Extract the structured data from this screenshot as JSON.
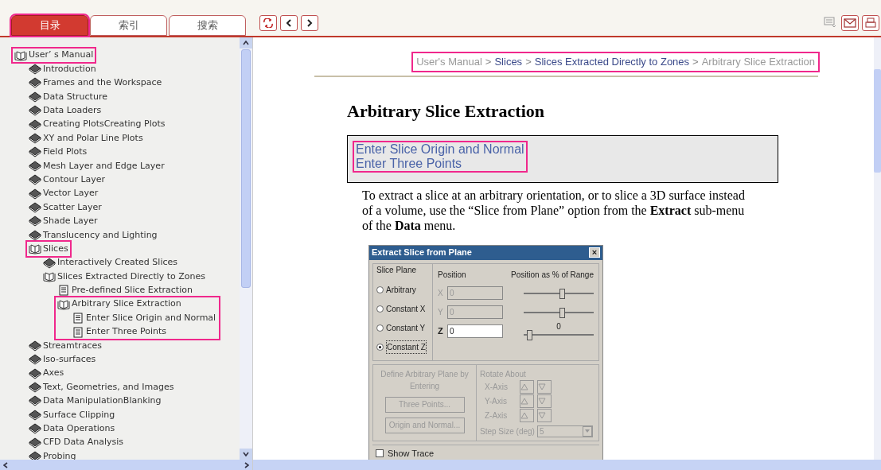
{
  "tabs": [
    {
      "label": "目录",
      "selected": true,
      "highlighted": true
    },
    {
      "label": "索引",
      "selected": false,
      "highlighted": false
    },
    {
      "label": "搜索",
      "selected": false,
      "highlighted": false
    }
  ],
  "tree": {
    "items": [
      {
        "label": "User’ s Manual",
        "kind": "book",
        "expanded": true,
        "highlighted": true,
        "highlight_children": false,
        "children": [
          {
            "label": "Introduction",
            "kind": "book",
            "expanded": false
          },
          {
            "label": "Frames and the Workspace",
            "kind": "book",
            "expanded": false
          },
          {
            "label": "Data Structure",
            "kind": "book",
            "expanded": false
          },
          {
            "label": "Data Loaders",
            "kind": "book",
            "expanded": false
          },
          {
            "label": "Creating PlotsCreating Plots",
            "kind": "book",
            "expanded": false
          },
          {
            "label": "XY and Polar Line Plots",
            "kind": "book",
            "expanded": false
          },
          {
            "label": "Field Plots",
            "kind": "book",
            "expanded": false
          },
          {
            "label": "Mesh Layer and Edge Layer",
            "kind": "book",
            "expanded": false
          },
          {
            "label": "Contour Layer",
            "kind": "book",
            "expanded": false
          },
          {
            "label": "Vector Layer",
            "kind": "book",
            "expanded": false
          },
          {
            "label": "Scatter Layer",
            "kind": "book",
            "expanded": false
          },
          {
            "label": "Shade Layer",
            "kind": "book",
            "expanded": false
          },
          {
            "label": "Translucency and Lighting",
            "kind": "book",
            "expanded": false
          },
          {
            "label": "Slices",
            "kind": "book",
            "expanded": true,
            "highlighted": true,
            "highlight_children": false,
            "children": [
              {
                "label": "Interactively Created Slices",
                "kind": "book",
                "expanded": false
              },
              {
                "label": "Slices Extracted Directly to Zones",
                "kind": "book",
                "expanded": true,
                "children": [
                  {
                    "label": "Pre-defined Slice Extraction",
                    "kind": "page"
                  },
                  {
                    "label": "Arbitrary Slice Extraction",
                    "kind": "book",
                    "expanded": true,
                    "highlighted": true,
                    "highlight_children": true,
                    "children": [
                      {
                        "label": "Enter Slice Origin and Normal",
                        "kind": "page"
                      },
                      {
                        "label": "Enter Three Points",
                        "kind": "page"
                      }
                    ]
                  }
                ]
              }
            ]
          },
          {
            "label": "Streamtraces",
            "kind": "book",
            "expanded": false
          },
          {
            "label": "Iso-surfaces",
            "kind": "book",
            "expanded": false
          },
          {
            "label": "Axes",
            "kind": "book",
            "expanded": false
          },
          {
            "label": "Text, Geometries, and Images",
            "kind": "book",
            "expanded": false
          },
          {
            "label": "Data ManipulationBlanking",
            "kind": "book",
            "expanded": false
          },
          {
            "label": "Surface Clipping",
            "kind": "book",
            "expanded": false
          },
          {
            "label": "Data Operations",
            "kind": "book",
            "expanded": false
          },
          {
            "label": "CFD Data Analysis",
            "kind": "book",
            "expanded": false
          },
          {
            "label": "Probing",
            "kind": "book",
            "expanded": false
          }
        ]
      }
    ]
  },
  "content": {
    "breadcrumb": {
      "highlighted": true,
      "separator": ">",
      "parts": [
        {
          "text": "User's Manual",
          "link": false
        },
        {
          "text": "Slices",
          "link": true
        },
        {
          "text": "Slices Extracted Directly to Zones",
          "link": true
        },
        {
          "text": "Arbitrary Slice Extraction",
          "link": false
        }
      ]
    },
    "title": "Arbitrary Slice Extraction",
    "links": {
      "highlighted": true,
      "items": [
        "Enter Slice Origin and Normal",
        "Enter Three Points"
      ]
    },
    "paragraph": "To extract a slice at an arbitrary orientation, or to slice a 3D surface instead of a volume, use the “Slice from Plane” option from the **Extract** sub-menu of the **Data** menu.",
    "dialog": {
      "title": "Extract Slice from Plane",
      "close": "×",
      "group": "Slice Plane",
      "radios": [
        {
          "label": "Arbitrary",
          "selected": false
        },
        {
          "label": "Constant X",
          "selected": false
        },
        {
          "label": "Constant Y",
          "selected": false
        },
        {
          "label": "Constant Z",
          "selected": true
        }
      ],
      "position_header": "Position",
      "range_header": "Position as % of Range",
      "fields": [
        {
          "axis": "X",
          "value": "0",
          "disabled": true,
          "level": 0.55
        },
        {
          "axis": "Y",
          "value": "0",
          "disabled": true,
          "level": 0.55
        },
        {
          "axis": "Z",
          "value": "0",
          "disabled": false,
          "level": 0.05,
          "reading": "0"
        }
      ],
      "define_label": "Define Arbitrary Plane by Entering",
      "define_buttons": [
        "Three Points...",
        "Origin and Normal..."
      ],
      "rotate_label": "Rotate About",
      "axes": [
        "X-Axis",
        "Y-Axis",
        "Z-Axis"
      ],
      "step_label": "Step Size (deg)",
      "step_value": "5",
      "show_trace": {
        "label": "Show Trace",
        "checked": false
      }
    }
  }
}
